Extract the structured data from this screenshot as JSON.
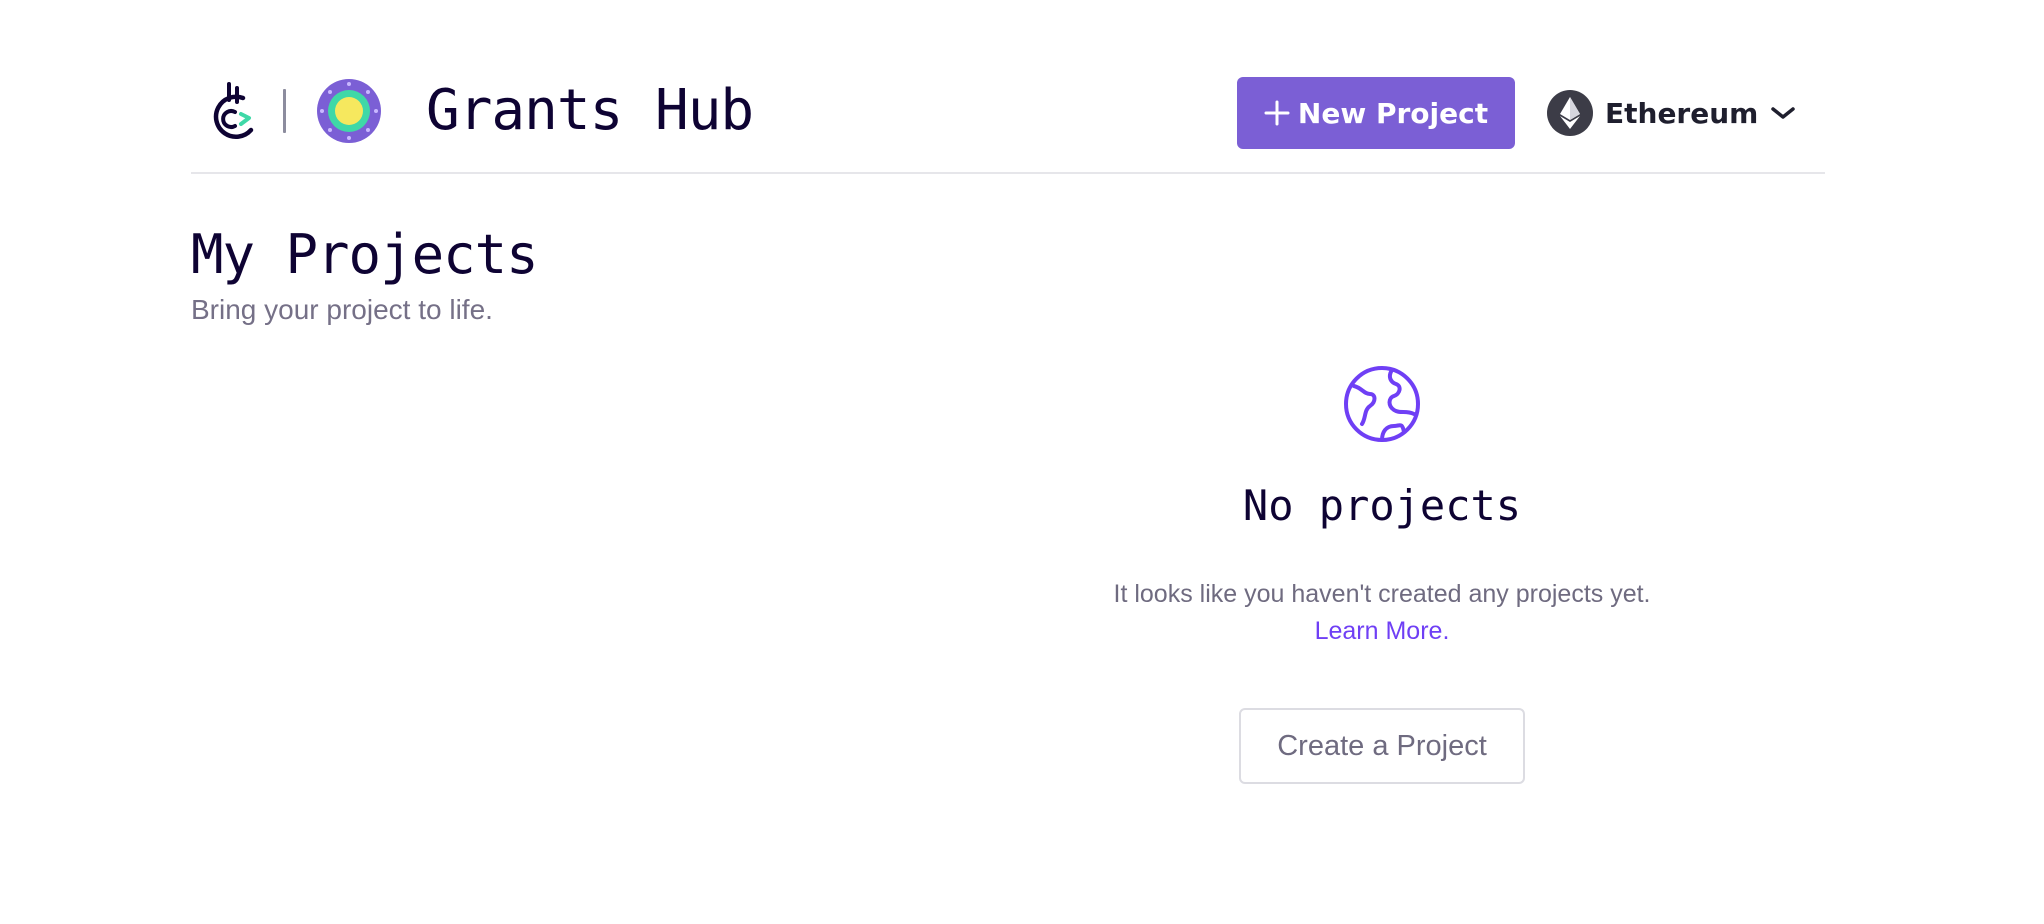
{
  "header": {
    "title": "Grants Hub",
    "new_project_label": "New Project",
    "network_label": "Ethereum",
    "icons": [
      "gitcoin-logo-icon",
      "grants-hub-logo-icon",
      "plus-icon",
      "ethereum-icon",
      "chevron-down-icon"
    ]
  },
  "main": {
    "title": "My Projects",
    "subtitle": "Bring your project to life."
  },
  "empty_state": {
    "icon": "globe-icon",
    "title": "No projects",
    "message": "It looks like you haven't created any projects yet.",
    "link_label": "Learn More.",
    "button_label": "Create a Project"
  },
  "colors": {
    "accent": "#7b5fd5",
    "link": "#6f3ff5",
    "heading": "#0e0333",
    "muted_text": "#757087",
    "divider": "#e6e6ea"
  }
}
